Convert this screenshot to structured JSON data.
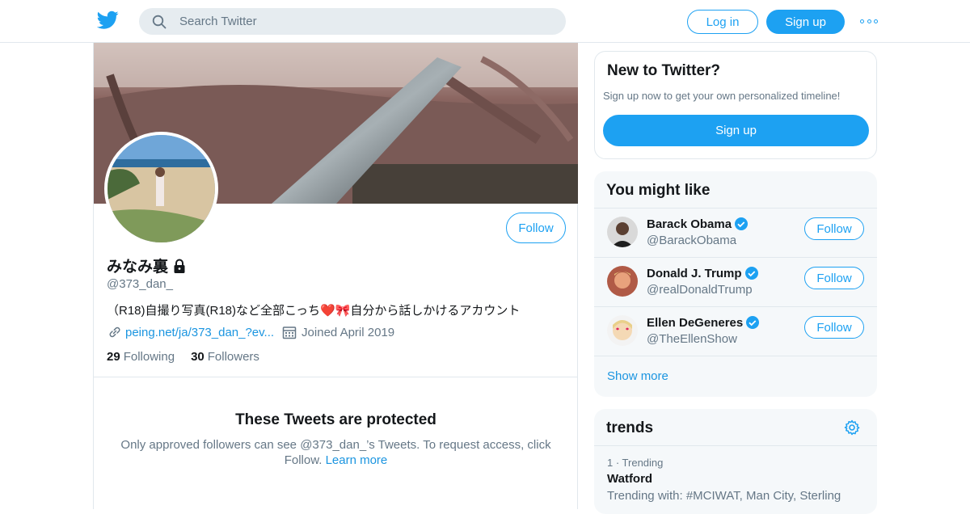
{
  "header": {
    "logo": "twitter-bird-icon",
    "search_placeholder": "Search Twitter",
    "login_label": "Log in",
    "signup_label": "Sign up",
    "more_icon": "more-dots-icon"
  },
  "profile": {
    "name": "みなみ裏",
    "locked_icon": "lock-icon",
    "handle": "@373_dan_",
    "bio": "（R18)自撮り写真(R18)など全部こっち❤️🎀自分から話しかけるアカウント",
    "link": "peing.net/ja/373_dan_?ev...",
    "joined": "Joined April 2019",
    "following_count": "29",
    "following_label": "Following",
    "followers_count": "30",
    "followers_label": "Followers",
    "follow_label": "Follow"
  },
  "protected": {
    "title": "These Tweets are protected",
    "text": "Only approved followers can see @373_dan_’s Tweets. To request access, click Follow.",
    "learn_more": "Learn more"
  },
  "sidebar": {
    "new_card": {
      "title": "New to Twitter?",
      "text": "Sign up now to get your own personalized timeline!",
      "signup_label": "Sign up"
    },
    "might_like": {
      "title": "You might like",
      "users": [
        {
          "name": "Barack Obama",
          "handle": "@BarackObama",
          "follow": "Follow"
        },
        {
          "name": "Donald J. Trump",
          "handle": "@realDonaldTrump",
          "follow": "Follow"
        },
        {
          "name": "Ellen DeGeneres",
          "handle": "@TheEllenShow",
          "follow": "Follow"
        }
      ],
      "show_more": "Show more"
    },
    "trends": {
      "title": "trends",
      "items": [
        {
          "rank": "1 · Trending",
          "name": "Watford",
          "with": "Trending with: #MCIWAT, Man City, Sterling"
        }
      ]
    }
  },
  "colors": {
    "accent": "#1da1f2",
    "link": "#1b95e0",
    "muted": "#657786",
    "card_bg": "#f5f8fa",
    "border": "#e1e8ed"
  }
}
